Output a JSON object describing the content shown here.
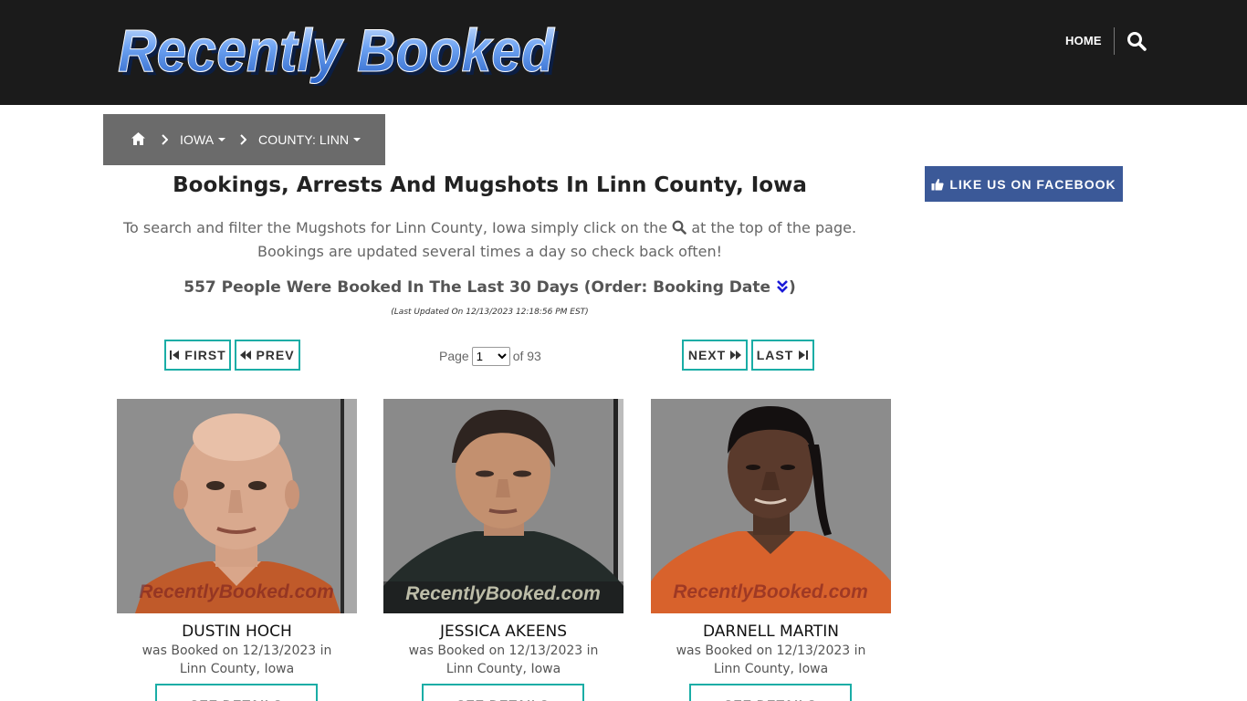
{
  "header": {
    "logo_text": "Recently Booked",
    "nav_home": "HOME",
    "icons": {
      "search": "search-icon"
    }
  },
  "breadcrumb": {
    "home_icon": "home-icon",
    "state": "IOWA",
    "county": "COUNTY: LINN"
  },
  "main": {
    "title": "Bookings, Arrests And Mugshots In Linn County, Iowa",
    "intro_before": "To search and filter the Mugshots for Linn County, Iowa simply click on the",
    "intro_after": "at the top of the page. Bookings are updated several times a day so check back often!",
    "count_text": "557 People Were Booked In The Last 30 Days (Order: Booking Date",
    "count_close": ")",
    "updated": "(Last Updated On 12/13/2023 12:18:56 PM EST)"
  },
  "pagination": {
    "first": "FIRST",
    "prev": "PREV",
    "page_label": "Page",
    "current_page": "1",
    "of_label": "of 93",
    "next": "NEXT",
    "last": "LAST"
  },
  "sidebar": {
    "facebook_label": "LIKE US ON FACEBOOK"
  },
  "cards": [
    {
      "name": "DUSTIN HOCH",
      "booked_line1": "was Booked on 12/13/2023 in",
      "booked_line2": "Linn County, Iowa",
      "watermark": "RecentlyBooked.com",
      "details": "SEE DETAILS"
    },
    {
      "name": "JESSICA AKEENS",
      "booked_line1": "was Booked on 12/13/2023 in",
      "booked_line2": "Linn County, Iowa",
      "watermark": "RecentlyBooked.com",
      "details": "SEE DETAILS"
    },
    {
      "name": "DARNELL MARTIN",
      "booked_line1": "was Booked on 12/13/2023 in",
      "booked_line2": "Linn County, Iowa",
      "watermark": "RecentlyBooked.com",
      "details": "SEE DETAILS"
    }
  ],
  "colors": {
    "topbar": "#1b1b1b",
    "breadcrumb": "#6b6b6b",
    "teal": "#1aada6",
    "facebook": "#3b5998",
    "logo_blue": "#3d7fe0"
  }
}
